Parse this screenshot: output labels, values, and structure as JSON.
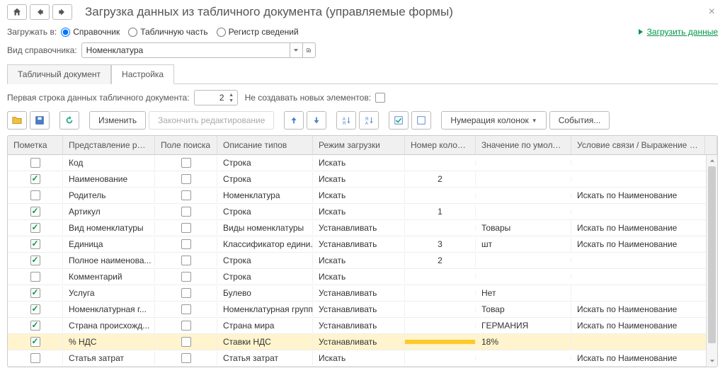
{
  "title": "Загрузка данных из табличного документа (управляемые формы)",
  "load_to_label": "Загружать в:",
  "radios": {
    "ref": "Справочник",
    "tab": "Табличную часть",
    "reg": "Регистр сведений"
  },
  "load_link": "Загрузить данные",
  "ref_type_label": "Вид справочника:",
  "ref_type_value": "Номенклатура",
  "tabs": {
    "doc": "Табличный документ",
    "settings": "Настройка"
  },
  "first_row_label": "Первая строка данных табличного документа:",
  "first_row_value": "2",
  "no_create_label": "Не создавать новых элементов:",
  "toolbar": {
    "edit": "Изменить",
    "finish": "Закончить редактирование",
    "numbering": "Нумерация колонок",
    "events": "События..."
  },
  "columns": {
    "mark": "Пометка",
    "repr": "Представление ре...",
    "field": "Поле поиска",
    "type": "Описание типов",
    "mode": "Режим загрузки",
    "num": "Номер колонки",
    "def": "Значение по умолча...",
    "cond": "Условие связи / Выражение д..."
  },
  "rows": [
    {
      "mark": false,
      "repr": "Код",
      "field": false,
      "type": "Строка",
      "mode": "Искать",
      "num": "",
      "def": "",
      "cond": ""
    },
    {
      "mark": true,
      "repr": "Наименование",
      "field": false,
      "type": "Строка",
      "mode": "Искать",
      "num": "2",
      "def": "",
      "cond": ""
    },
    {
      "mark": false,
      "repr": "Родитель",
      "field": false,
      "type": "Номенклатура",
      "mode": "Искать",
      "num": "",
      "def": "",
      "cond": "Искать по Наименование"
    },
    {
      "mark": true,
      "repr": "Артикул",
      "field": false,
      "type": "Строка",
      "mode": "Искать",
      "num": "1",
      "def": "",
      "cond": ""
    },
    {
      "mark": true,
      "repr": "Вид номенклатуры",
      "field": false,
      "type": "Виды номенклатуры",
      "mode": "Устанавливать",
      "num": "",
      "def": "Товары",
      "cond": "Искать по Наименование"
    },
    {
      "mark": true,
      "repr": "Единица",
      "field": false,
      "type": "Классификатор едини...",
      "mode": "Устанавливать",
      "num": "3",
      "def": "шт",
      "cond": "Искать по Наименование"
    },
    {
      "mark": true,
      "repr": "Полное наименова...",
      "field": false,
      "type": "Строка",
      "mode": "Искать",
      "num": "2",
      "def": "",
      "cond": ""
    },
    {
      "mark": false,
      "repr": "Комментарий",
      "field": false,
      "type": "Строка",
      "mode": "Искать",
      "num": "",
      "def": "",
      "cond": ""
    },
    {
      "mark": true,
      "repr": "Услуга",
      "field": false,
      "type": "Булево",
      "mode": "Устанавливать",
      "num": "",
      "def": "Нет",
      "cond": ""
    },
    {
      "mark": true,
      "repr": "Номенклатурная г...",
      "field": false,
      "type": "Номенклатурная группа",
      "mode": "Устанавливать",
      "num": "",
      "def": "Товар",
      "cond": "Искать по Наименование"
    },
    {
      "mark": true,
      "repr": "Страна происхожд...",
      "field": false,
      "type": "Страна мира",
      "mode": "Устанавливать",
      "num": "",
      "def": "ГЕРМАНИЯ",
      "cond": "Искать по Наименование"
    },
    {
      "mark": true,
      "repr": "% НДС",
      "field": false,
      "type": "Ставки НДС",
      "mode": "Устанавливать",
      "num": "",
      "def": "18%",
      "cond": "",
      "sel": true
    },
    {
      "mark": false,
      "repr": "Статья затрат",
      "field": false,
      "type": "Статья затрат",
      "mode": "Искать",
      "num": "",
      "def": "",
      "cond": "Искать по Наименование"
    }
  ]
}
